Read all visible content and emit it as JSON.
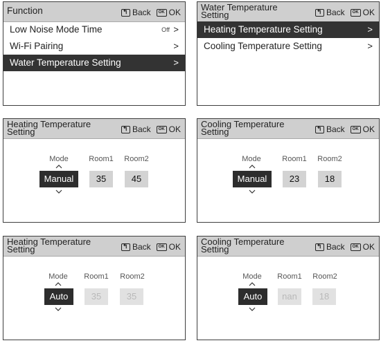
{
  "softkeys": {
    "back": "Back",
    "ok": "OK",
    "ok_icon_text": "OK"
  },
  "panels": {
    "function": {
      "title": "Function",
      "items": [
        {
          "label": "Low Noise Mode Time",
          "value": "Off"
        },
        {
          "label": "Wi-Fi Pairing",
          "value": ""
        },
        {
          "label": "Water Temperature Setting",
          "value": ""
        }
      ],
      "selected": "Water Temperature Setting"
    },
    "water_temp": {
      "title": "Water Temperature Setting",
      "items": [
        {
          "label": "Heating Temperature Setting"
        },
        {
          "label": "Cooling Temperature Setting"
        }
      ],
      "selected": "Heating Temperature Setting"
    },
    "heating_manual": {
      "title": "Heating Temperature Setting",
      "mode_label": "Mode",
      "room1_label": "Room1",
      "room2_label": "Room2",
      "mode": "Manual",
      "room1": "35",
      "room2": "45"
    },
    "cooling_manual": {
      "title": "Cooling Temperature Setting",
      "mode_label": "Mode",
      "room1_label": "Room1",
      "room2_label": "Room2",
      "mode": "Manual",
      "room1": "23",
      "room2": "18"
    },
    "heating_auto": {
      "title": "Heating Temperature Setting",
      "mode_label": "Mode",
      "room1_label": "Room1",
      "room2_label": "Room2",
      "mode": "Auto",
      "room1": "35",
      "room2": "35"
    },
    "cooling_auto": {
      "title": "Cooling Temperature Setting",
      "mode_label": "Mode",
      "room1_label": "Room1",
      "room2_label": "Room2",
      "mode": "Auto",
      "room1": "nan",
      "room2": "18"
    }
  },
  "colors": {
    "header_bg": "#cfcfcf",
    "selected_row_bg": "#333333",
    "mode_box_bg": "#2d2d2d",
    "value_box_bg": "#d3d3d3",
    "disabled_value_text": "#b9b9b9"
  }
}
